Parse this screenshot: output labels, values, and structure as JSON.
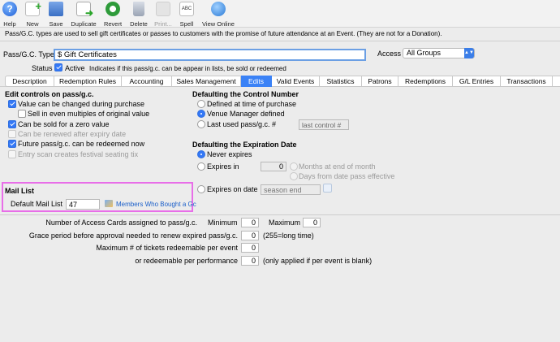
{
  "toolbar": {
    "items": [
      {
        "label": "Help",
        "icon": "help-icon"
      },
      {
        "label": "New",
        "icon": "new-icon"
      },
      {
        "label": "Save",
        "icon": "save-icon"
      },
      {
        "label": "Duplicate",
        "icon": "duplicate-icon"
      },
      {
        "label": "Revert",
        "icon": "revert-icon"
      },
      {
        "label": "Delete",
        "icon": "delete-icon"
      },
      {
        "label": "Print...",
        "icon": "print-icon"
      },
      {
        "label": "Spell",
        "icon": "spell-icon"
      },
      {
        "label": "View Online",
        "icon": "view-online-icon"
      }
    ]
  },
  "description": "Pass/G.C. types are used to sell gift certificates or passes to customers with the promise of future attendance at an Event.  (They are not for a Donation).",
  "header": {
    "type_label": "Pass/G.C. Type",
    "type_value": "$ Gift Certificates",
    "access_label": "Access",
    "access_value": "All Groups",
    "status_label": "Status",
    "active_label": "Active",
    "status_note": "Indicates if this pass/g.c. can be appear in lists, be sold or redeemed"
  },
  "tabs": [
    "Description",
    "Redemption Rules",
    "Accounting",
    "Sales Management",
    "Edits",
    "Valid Events",
    "Statistics",
    "Patrons",
    "Redemptions",
    "G/L Entries",
    "Transactions"
  ],
  "edit_controls": {
    "title": "Edit controls on pass/g.c.",
    "options": [
      "Value can be changed during purchase",
      "Sell in even multiples of original value",
      "Can be sold for a zero value",
      "Can be renewed after expiry date",
      "Future pass/g.c. can be redeemed now",
      "Entry scan creates festival seating tix"
    ]
  },
  "control_number": {
    "title": "Defaulting the Control Number",
    "options": [
      "Defined at time of purchase",
      "Venue Manager defined",
      "Last used pass/g.c. #"
    ],
    "last_control": "last control #"
  },
  "expiration": {
    "title": "Defaulting the Expiration Date",
    "never": "Never expires",
    "expires_in": "Expires in",
    "expires_in_value": "0",
    "months_end": "Months at end of month",
    "days_from": "Days from date pass effective",
    "expires_on": "Expires on date",
    "season_end": "season end"
  },
  "mail_list": {
    "title": "Mail List",
    "default_label": "Default Mail List",
    "default_value": "47",
    "link_text": "Members Who Bought a Gc"
  },
  "counts": {
    "access_cards_label": "Number of Access Cards assigned to pass/g.c.",
    "minimum_label": "Minimum",
    "minimum_value": "0",
    "maximum_label": "Maximum",
    "maximum_value": "0",
    "grace_label": "Grace period before approval needed to renew expired pass/g.c.",
    "grace_value": "0",
    "grace_note": "(255=long time)",
    "max_event_label": "Maximum # of tickets redeemable per event",
    "max_event_value": "0",
    "per_perf_label": "or redeemable per performance",
    "per_perf_value": "0",
    "per_perf_note": "(only applied if per event is blank)"
  }
}
